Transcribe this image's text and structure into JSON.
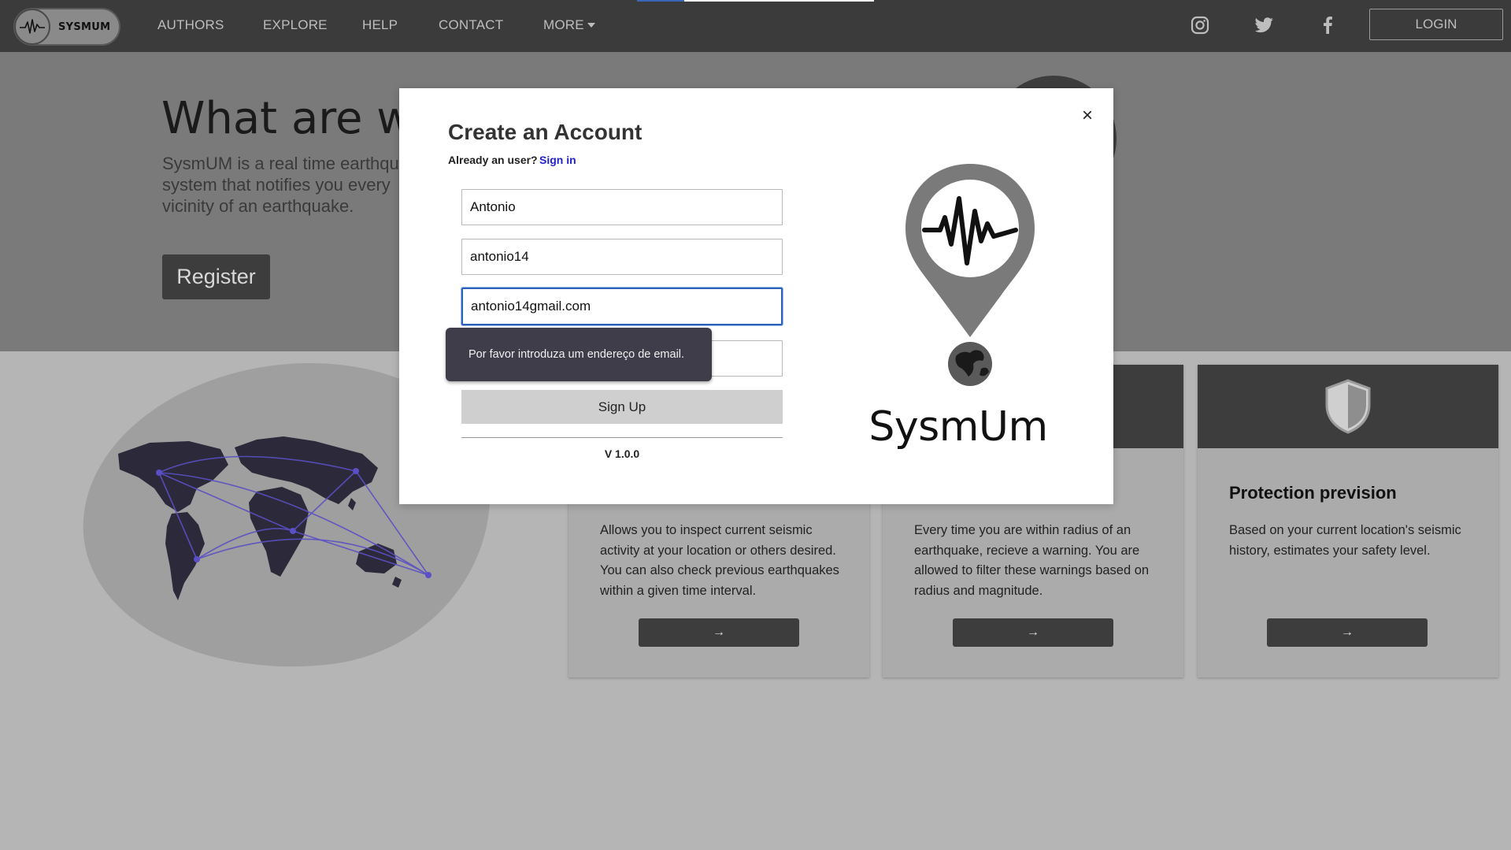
{
  "navbar": {
    "brand_name": "SYSMUM",
    "links": [
      "AUTHORS",
      "EXPLORE",
      "HELP",
      "CONTACT",
      "MORE"
    ],
    "login_label": "LOGIN",
    "social_icons": [
      "instagram-icon",
      "twitter-icon",
      "facebook-icon"
    ],
    "page_load_progress": 0.2
  },
  "hero": {
    "title": "What are we",
    "text": "SysmUM is a real time earthqu system that notifies you every vicinity of an earthquake.",
    "register_label": "Register"
  },
  "cards": [
    {
      "title": "",
      "text": "Allows you to inspect current seismic activity at your location or others desired. You can also check previous earthquakes within a given time interval.",
      "arrow": "→"
    },
    {
      "title": "",
      "text": "Every time you are within radius of an earthquake, recieve a warning. You are allowed to filter these warnings based on radius and magnitude.",
      "arrow": "→"
    },
    {
      "title": "Protection prevision",
      "text": "Based on your current location's seismic history, estimates your safety level.",
      "arrow": "→",
      "icon": "shield-icon"
    }
  ],
  "modal": {
    "title": "Create an Account",
    "already_label": "Already an user?",
    "signin_label": "Sign in",
    "close_label": "×",
    "fields": {
      "name": "Antonio",
      "username": "antonio14",
      "email": "antonio14gmail.com",
      "password": ""
    },
    "signup_label": "Sign Up",
    "version": "V 1.0.0",
    "brand": "SysmUm"
  },
  "tooltip": {
    "text": "Por favor introduza um endereço de email."
  },
  "colors": {
    "navbar_bg": "#3b3b3b",
    "focus_blue": "#2a62b8",
    "link_blue": "#2222cc",
    "tooltip_bg": "#3f3d4a"
  }
}
